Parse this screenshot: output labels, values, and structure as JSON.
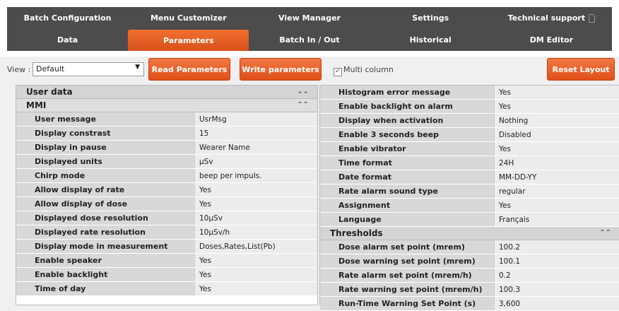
{
  "nav": {
    "row1": [
      "Batch Configuration",
      "Menu Customizer",
      "View Manager",
      "Settings",
      "Technical support"
    ],
    "row2": [
      "Data",
      "Parameters",
      "Batch In / Out",
      "Historical",
      "DM Editor"
    ]
  },
  "toolbar": {
    "view_label": "View :",
    "view_value": "Default",
    "read_label": "Read Parameters",
    "write_label": "Write parameters",
    "multi_label": "Multi column",
    "reset_label": "Reset Layout"
  },
  "left": {
    "user_data_title": "User data",
    "mmi_title": "MMI",
    "rows": [
      {
        "name": "User message",
        "value": "UsrMsg"
      },
      {
        "name": "Display constrast",
        "value": "15"
      },
      {
        "name": "Display in pause",
        "value": "Wearer Name"
      },
      {
        "name": "Displayed units",
        "value": "µSv"
      },
      {
        "name": "Chirp mode",
        "value": "beep per impuls."
      },
      {
        "name": "Allow display of rate",
        "value": "Yes"
      },
      {
        "name": "Allow display of dose",
        "value": "Yes"
      },
      {
        "name": "Displayed dose resolution",
        "value": "10µSv"
      },
      {
        "name": "Displayed rate resolution",
        "value": "10µSv/h"
      },
      {
        "name": "Display mode in measurement",
        "value": "Doses,Rates,List(Pb)"
      },
      {
        "name": "Enable speaker",
        "value": "Yes"
      },
      {
        "name": "Enable backlight",
        "value": "Yes"
      },
      {
        "name": "Time of day",
        "value": "Yes"
      }
    ]
  },
  "right": {
    "rows": [
      {
        "name": "Histogram error message",
        "value": "Yes"
      },
      {
        "name": "Enable backlight on alarm",
        "value": "Yes"
      },
      {
        "name": "Display when activation",
        "value": "Nothing"
      },
      {
        "name": "Enable 3 seconds beep",
        "value": "Disabled"
      },
      {
        "name": "Enable vibrator",
        "value": "Yes"
      },
      {
        "name": "Time format",
        "value": "24H"
      },
      {
        "name": "Date format",
        "value": "MM-DD-YY"
      },
      {
        "name": "Rate alarm sound type",
        "value": "regular"
      },
      {
        "name": "Assignment",
        "value": "Yes"
      },
      {
        "name": "Language",
        "value": "Français"
      }
    ],
    "thresholds_title": "Thresholds",
    "threshold_rows": [
      {
        "name": "Dose alarm set point (mrem)",
        "value": "100.2"
      },
      {
        "name": "Dose warning set point (mrem)",
        "value": "100.1"
      },
      {
        "name": "Rate alarm set point (mrem/h)",
        "value": "0.2"
      },
      {
        "name": "Rate warning set point (mrem/h)",
        "value": "100.3"
      },
      {
        "name": "Run-Time Warning Set Point  (s)",
        "value": "3,600"
      }
    ]
  }
}
